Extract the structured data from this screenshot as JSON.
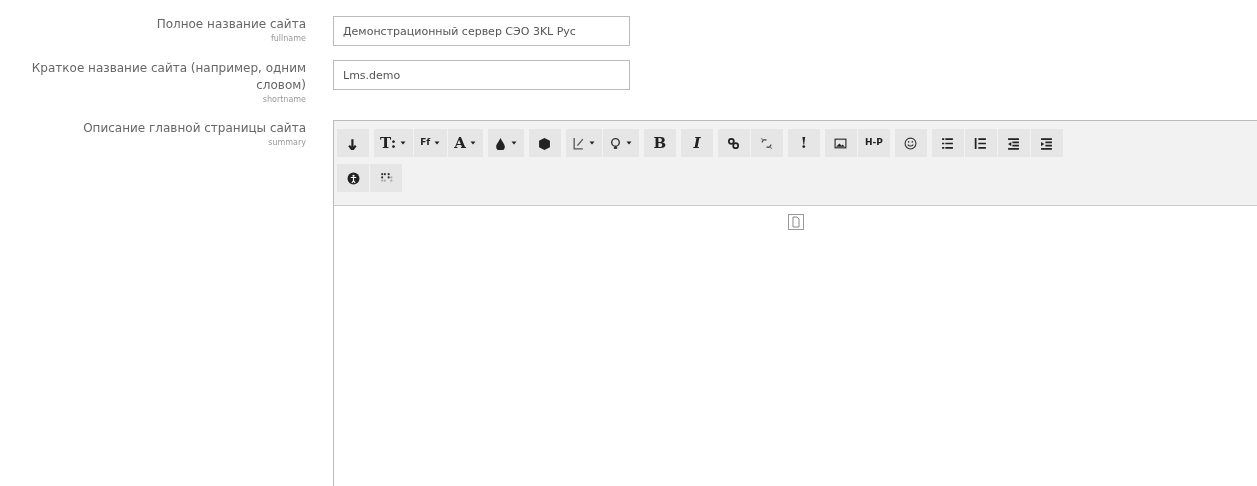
{
  "fields": [
    {
      "label": "Полное название сайта",
      "name": "fullname",
      "kind": "text",
      "value": "Демонстрационный сервер СЭО 3KL Рус"
    },
    {
      "label": "Краткое название сайта (например, одним словом)",
      "name": "shortname",
      "kind": "text",
      "value": "Lms.demo"
    },
    {
      "label": "Описание главной страницы сайта",
      "name": "summary",
      "kind": "editor"
    }
  ],
  "toolbar": [
    [
      [
        {
          "kind": "collapse",
          "dropdown": false
        }
      ],
      [
        {
          "kind": "text",
          "glyph": "T:",
          "dropdown": true
        },
        {
          "kind": "text",
          "glyph": "Ff",
          "dropdown": true,
          "small": true
        },
        {
          "kind": "text",
          "glyph": "A",
          "dropdown": true
        }
      ],
      [
        {
          "kind": "drop",
          "dropdown": true
        }
      ],
      [
        {
          "kind": "cube",
          "dropdown": false
        }
      ],
      [
        {
          "kind": "pen",
          "dropdown": true
        },
        {
          "kind": "bulb",
          "dropdown": true
        }
      ],
      [
        {
          "kind": "text",
          "glyph": "B",
          "dropdown": false
        }
      ],
      [
        {
          "kind": "text",
          "glyph": "I",
          "dropdown": false,
          "italic": true
        }
      ],
      [
        {
          "kind": "link",
          "dropdown": false
        },
        {
          "kind": "unlink",
          "dropdown": false
        }
      ],
      [
        {
          "kind": "text",
          "glyph": "!",
          "dropdown": false
        }
      ],
      [
        {
          "kind": "image",
          "dropdown": false
        },
        {
          "kind": "text",
          "glyph": "H-P",
          "dropdown": false,
          "small": true
        }
      ],
      [
        {
          "kind": "smiley",
          "dropdown": false
        }
      ],
      [
        {
          "kind": "ul",
          "dropdown": false
        },
        {
          "kind": "ol",
          "dropdown": false
        },
        {
          "kind": "outdent",
          "dropdown": false
        },
        {
          "kind": "indent",
          "dropdown": false
        }
      ]
    ],
    [
      [
        {
          "kind": "accessibility",
          "dropdown": false
        },
        {
          "kind": "braille",
          "dropdown": false
        }
      ]
    ]
  ]
}
